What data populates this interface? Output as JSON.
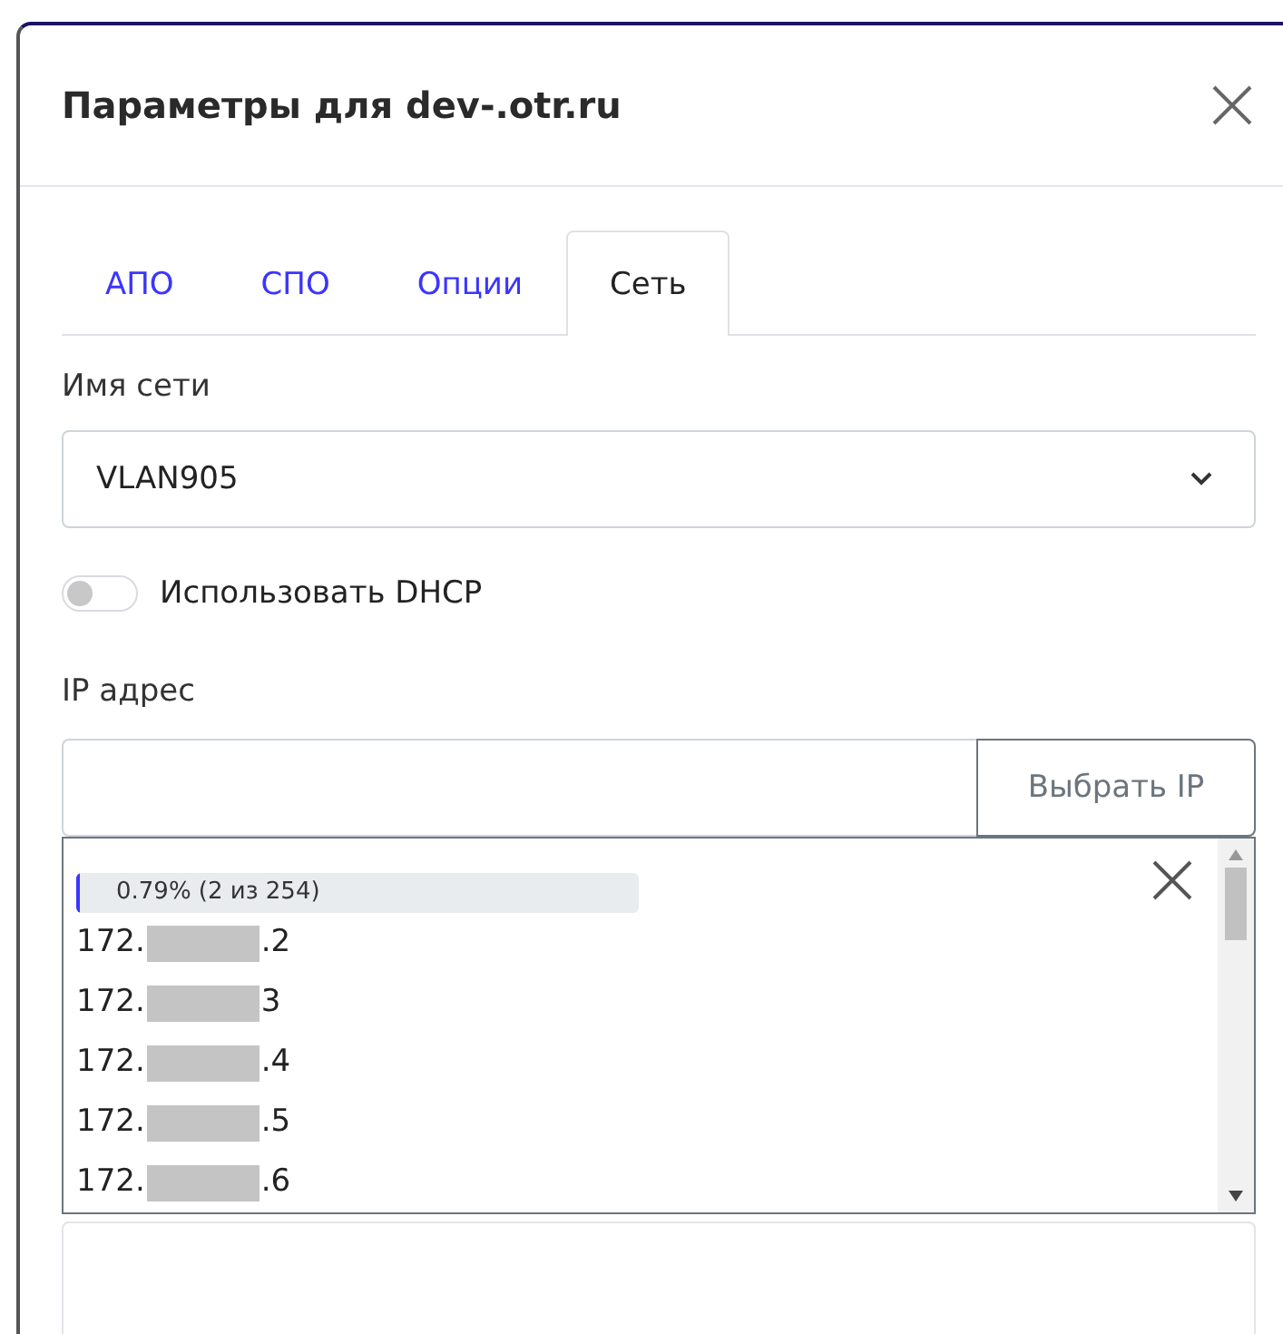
{
  "dialog": {
    "title": "Параметры для dev-.otr.ru"
  },
  "tabs": [
    {
      "label": "АПО",
      "selected": false
    },
    {
      "label": "СПО",
      "selected": false
    },
    {
      "label": "Опции",
      "selected": false
    },
    {
      "label": "Сеть",
      "selected": true
    }
  ],
  "network": {
    "label": "Имя сети",
    "value": "VLAN905"
  },
  "dhcp": {
    "label": "Использовать DHCP",
    "on": false
  },
  "ip": {
    "label": "IP адрес",
    "button": "Выбрать IP"
  },
  "ip_list": {
    "progress": {
      "level": 0.0079,
      "text": "0.79% (2 из 254)"
    },
    "items": [
      {
        "prefix": "172.",
        "suffix": ".2"
      },
      {
        "prefix": "172.",
        "suffix": "3"
      },
      {
        "prefix": "172.",
        "suffix": ".4"
      },
      {
        "prefix": "172.",
        "suffix": ".5"
      },
      {
        "prefix": "172.",
        "suffix": ".6"
      }
    ]
  }
}
